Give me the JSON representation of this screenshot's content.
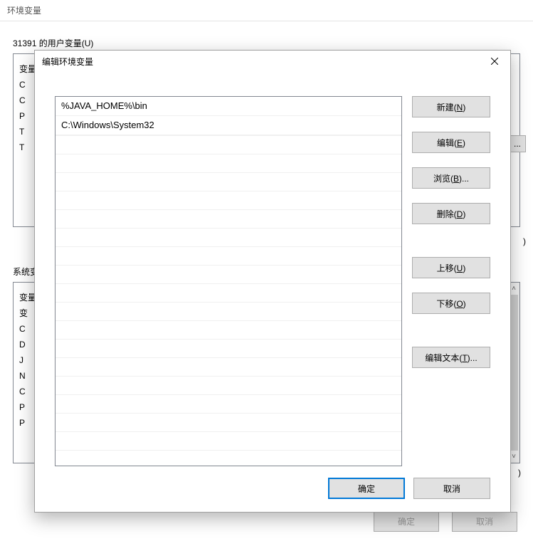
{
  "bgWindow": {
    "title": "环境变量",
    "userVarsLabel": "31391 的用户变量(U)",
    "systemVarsLabel": "系统变量(S)",
    "userVarHeader": "变量",
    "userRows": [
      "C",
      "C",
      "P",
      "T",
      "T"
    ],
    "sysRows": [
      "变",
      "C",
      "D",
      "J",
      "N",
      "C",
      "P",
      "P"
    ],
    "ellipsis": "...",
    "closeParen": ")",
    "confirmGhost": "确定",
    "cancelGhost": "取消"
  },
  "dialog": {
    "title": "编辑环境变量",
    "paths": [
      "%JAVA_HOME%\\bin",
      "C:\\Windows\\System32"
    ],
    "buttons": {
      "new": "新建(N)",
      "edit": "编辑(E)",
      "browse": "浏览(B)...",
      "delete": "删除(D)",
      "moveUp": "上移(U)",
      "moveDown": "下移(O)",
      "editText": "编辑文本(T)..."
    },
    "ok": "确定",
    "cancel": "取消"
  }
}
